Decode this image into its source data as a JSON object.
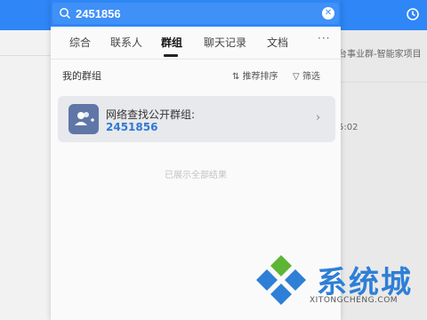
{
  "search": {
    "query": "2451856"
  },
  "tabs": [
    {
      "label": "综合"
    },
    {
      "label": "联系人"
    },
    {
      "label": "群组"
    },
    {
      "label": "聊天记录"
    },
    {
      "label": "文档"
    }
  ],
  "active_tab": "群组",
  "more_label": "···",
  "section": {
    "title": "我的群组",
    "sort_label": "推荐排序",
    "filter_label": "筛选"
  },
  "result": {
    "title": "网络查找公开群组:",
    "id": "2451856"
  },
  "end_text": "已展示全部结果",
  "background": {
    "right_text": "台事业群-智能家项目",
    "time_text": "5:02"
  },
  "watermark": {
    "text": "系统城",
    "url": "XITONGCHENG.COM"
  },
  "colors": {
    "accent": "#2f86f6",
    "link": "#2f78d6",
    "avatar": "#5f76a6"
  }
}
